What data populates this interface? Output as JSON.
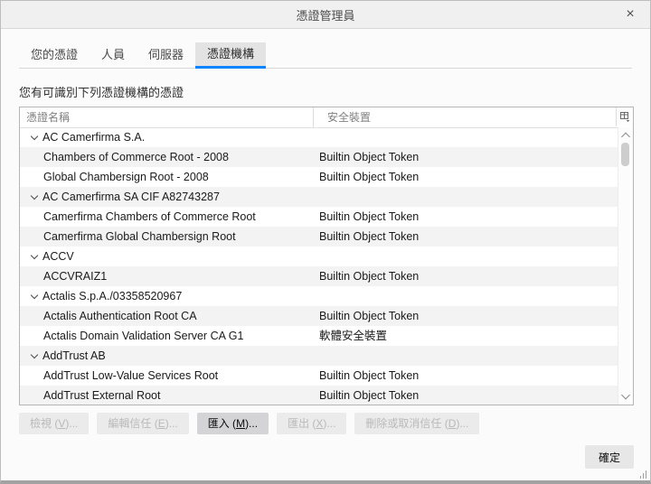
{
  "window": {
    "title": "憑證管理員"
  },
  "icons": {
    "close_glyph": "×",
    "close": "close-icon",
    "column_picker": "column-picker-icon",
    "group_chevron": "chevron-down-icon"
  },
  "tabs": [
    {
      "id": "your-certificates",
      "label": "您的憑證",
      "active": false
    },
    {
      "id": "people",
      "label": "人員",
      "active": false
    },
    {
      "id": "servers",
      "label": "伺服器",
      "active": false
    },
    {
      "id": "authorities",
      "label": "憑證機構",
      "active": true
    }
  ],
  "description": "您有可識別下列憑證機構的憑證",
  "table": {
    "columns": [
      "憑證名稱",
      "安全裝置"
    ],
    "rows": [
      {
        "type": "group",
        "name": "AC Camerfirma S.A.",
        "device": ""
      },
      {
        "type": "child",
        "name": "Chambers of Commerce Root - 2008",
        "device": "Builtin Object Token"
      },
      {
        "type": "child",
        "name": "Global Chambersign Root - 2008",
        "device": "Builtin Object Token"
      },
      {
        "type": "group",
        "name": "AC Camerfirma SA CIF A82743287",
        "device": ""
      },
      {
        "type": "child",
        "name": "Camerfirma Chambers of Commerce Root",
        "device": "Builtin Object Token"
      },
      {
        "type": "child",
        "name": "Camerfirma Global Chambersign Root",
        "device": "Builtin Object Token"
      },
      {
        "type": "group",
        "name": "ACCV",
        "device": ""
      },
      {
        "type": "child",
        "name": "ACCVRAIZ1",
        "device": "Builtin Object Token"
      },
      {
        "type": "group",
        "name": "Actalis S.p.A./03358520967",
        "device": ""
      },
      {
        "type": "child",
        "name": "Actalis Authentication Root CA",
        "device": "Builtin Object Token"
      },
      {
        "type": "child",
        "name": "Actalis Domain Validation Server CA G1",
        "device": "軟體安全裝置"
      },
      {
        "type": "group",
        "name": "AddTrust AB",
        "device": ""
      },
      {
        "type": "child",
        "name": "AddTrust Low-Value Services Root",
        "device": "Builtin Object Token"
      },
      {
        "type": "child",
        "name": "AddTrust External Root",
        "device": "Builtin Object Token"
      }
    ]
  },
  "footer": {
    "buttons": [
      {
        "name": "view-button",
        "pre": "檢視 (",
        "key": "V",
        "post": ")...",
        "enabled": false
      },
      {
        "name": "edit-trust-button",
        "pre": "編輯信任 (",
        "key": "E",
        "post": ")...",
        "enabled": false
      },
      {
        "name": "import-button",
        "pre": "匯入 (",
        "key": "M",
        "post": ")...",
        "enabled": true
      },
      {
        "name": "export-button",
        "pre": "匯出 (",
        "key": "X",
        "post": ")...",
        "enabled": false
      },
      {
        "name": "delete-or-distrust-button",
        "pre": "刪除或取消信任 (",
        "key": "D",
        "post": ")...",
        "enabled": false
      }
    ],
    "ok_label": "確定"
  },
  "colors": {
    "accent": "#0a84ff",
    "stripe": "#f3f3f3",
    "titlebar_bg": "#f0f0f0",
    "body_bg": "#fbfbfb"
  }
}
